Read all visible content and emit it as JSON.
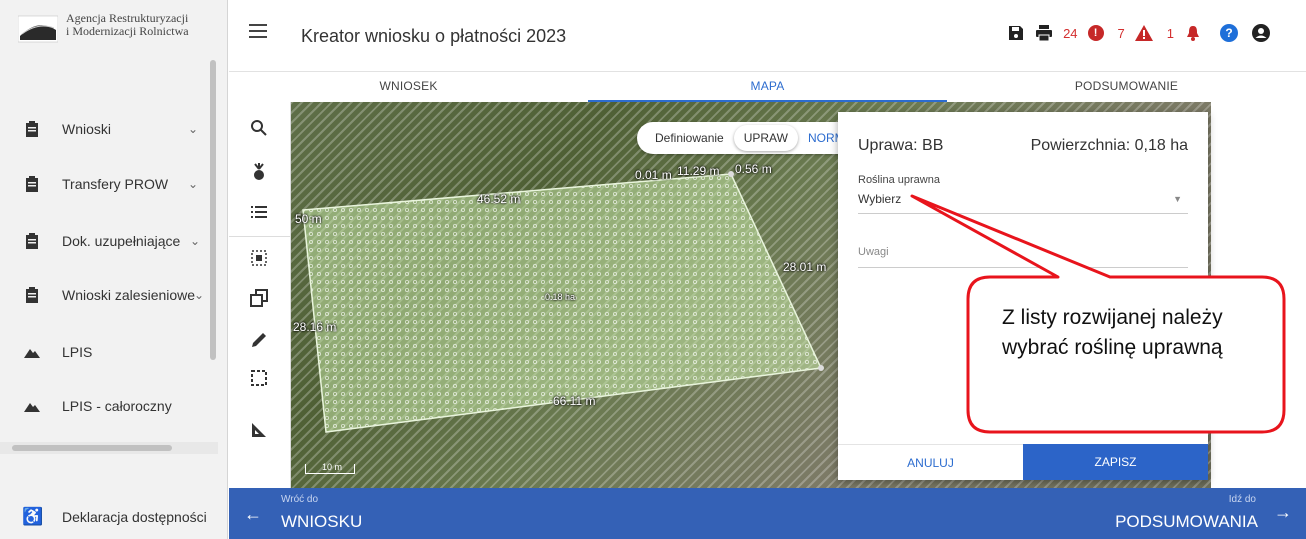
{
  "brand": {
    "line1": "Agencja Restrukturyzacji",
    "line2": "i Modernizacji Rolnictwa"
  },
  "sidebar": {
    "items": [
      {
        "label": "Wnioski",
        "icon": "clipboard-icon"
      },
      {
        "label": "Transfery PROW",
        "icon": "clipboard-icon"
      },
      {
        "label": "Dok. uzupełniające",
        "icon": "clipboard-icon"
      },
      {
        "label": "Wnioski zalesieniowe",
        "icon": "clipboard-icon"
      },
      {
        "label": "LPIS",
        "icon": "mountain-icon"
      },
      {
        "label": "LPIS - całoroczny",
        "icon": "mountain-icon"
      }
    ],
    "accessibility": "Deklaracja dostępności"
  },
  "header": {
    "title": "Kreator wniosku o płatności 2023",
    "errors_count": "24",
    "warnings_count": "7",
    "notifications_count": "1"
  },
  "tabs": [
    "WNIOSEK",
    "MAPA",
    "PODSUMOWANIE"
  ],
  "map": {
    "toggle_label": "Definiowanie",
    "toggle_option_active": "UPRAW",
    "toggle_option_other": "NORM",
    "measures": {
      "m1": "0.01 m",
      "m2": "11.29 m",
      "m3": "0.56 m",
      "top": "46.52 m",
      "left_top": "50 m",
      "right": "28.01 m",
      "left": "28.16 m",
      "bottom": "66.11 m",
      "area": "0.18 ha"
    },
    "scale_label": "10 m"
  },
  "dialog": {
    "title": "Uprawa: BB",
    "area": "Powierzchnia: 0,18 ha",
    "crop_label": "Roślina uprawna",
    "crop_value": "Wybierz",
    "notes_placeholder": "Uwagi",
    "cancel": "ANULUJ",
    "save": "ZAPISZ"
  },
  "callout": {
    "text": "Z listy rozwijanej należy wybrać roślinę uprawną"
  },
  "bottom_nav": {
    "back_small": "Wróć do",
    "back_big": "WNIOSKU",
    "next_small": "Idź do",
    "next_big": "PODSUMOWANIA"
  },
  "colors": {
    "accent": "#2c6ccf",
    "nav_bar": "#3461b6",
    "callout_red": "#e8141c",
    "parcel": "#c5e6a6"
  }
}
